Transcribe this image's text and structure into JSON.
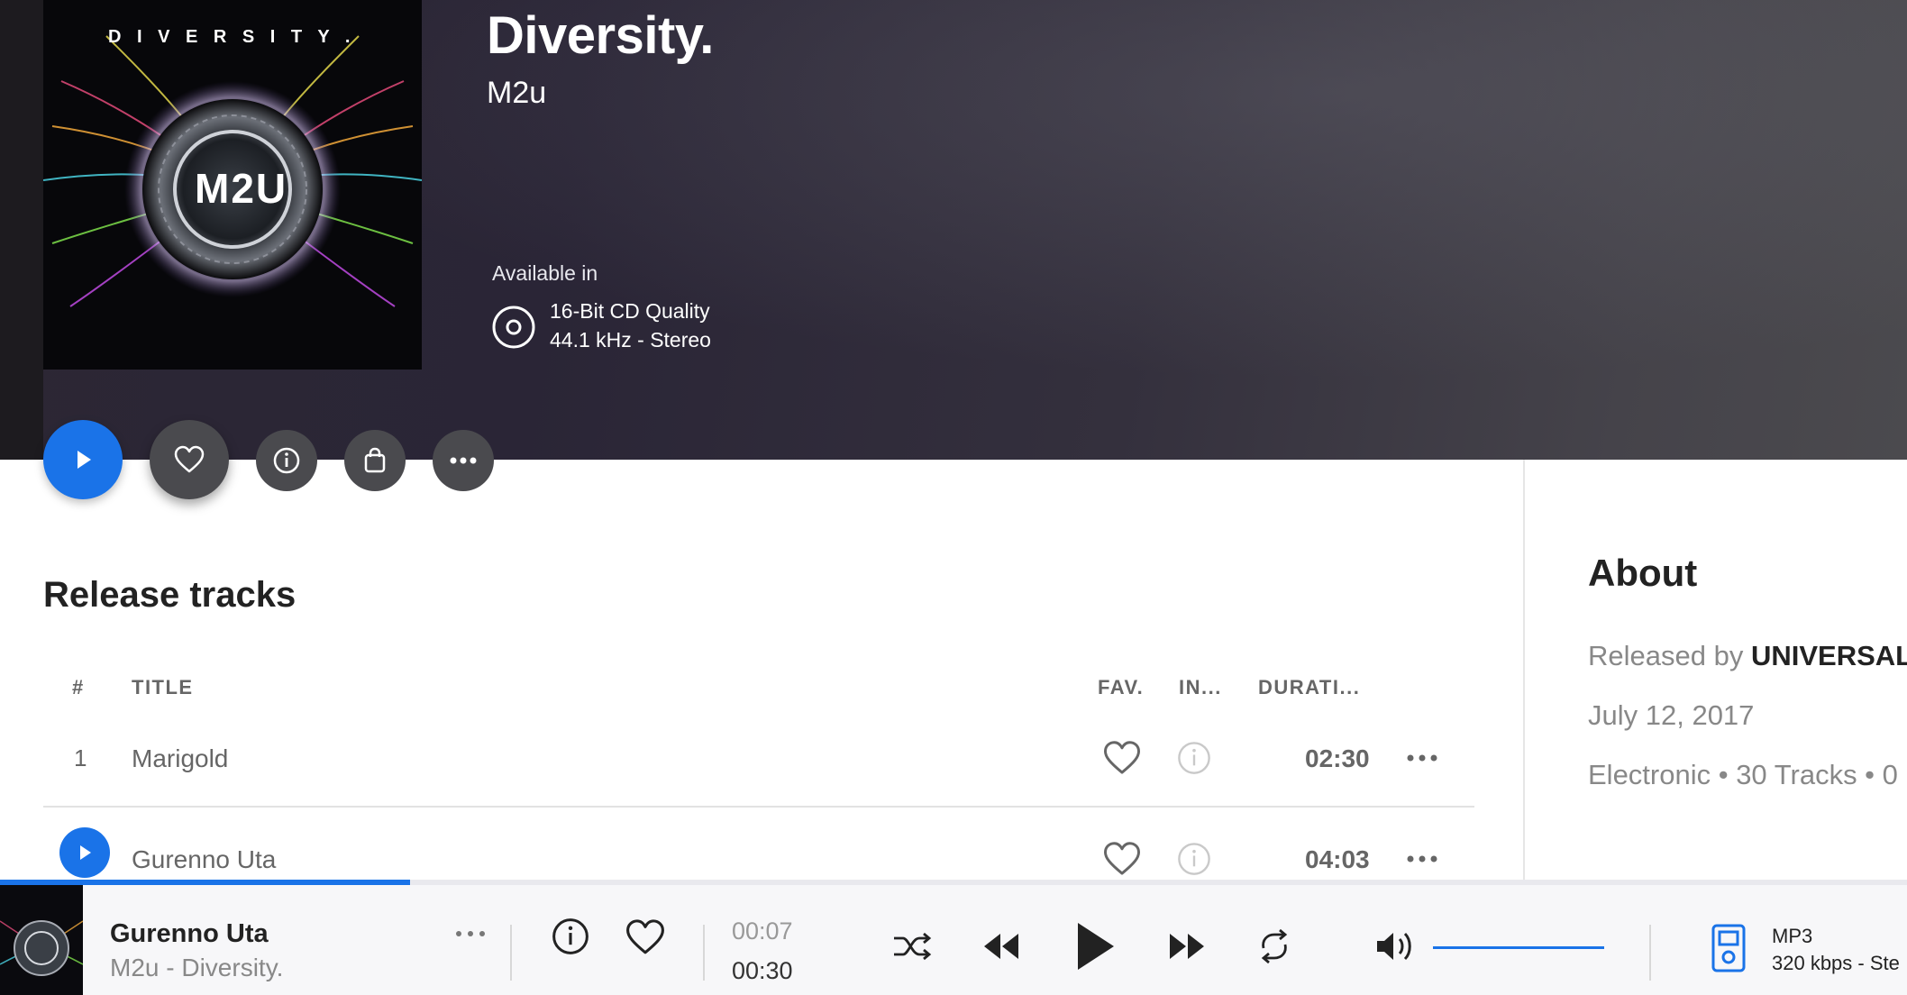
{
  "album": {
    "cover_text": "D I V E R S I T Y .",
    "cover_logo_text": "M2U",
    "title": "Diversity.",
    "artist": "M2u",
    "available_label": "Available in",
    "quality_line1": "16-Bit CD Quality",
    "quality_line2": "44.1 kHz - Stereo"
  },
  "actions": {
    "play_icon": "play-icon",
    "favorite_icon": "heart-icon",
    "info_icon": "info-icon",
    "buy_icon": "shopping-bag-icon",
    "more_icon": "more-icon"
  },
  "tracks": {
    "section_title": "Release tracks",
    "columns": {
      "number": "#",
      "title": "TITLE",
      "fav": "FAV.",
      "info": "IN...",
      "duration": "DURATI..."
    },
    "rows": [
      {
        "number": "1",
        "title": "Marigold",
        "duration": "02:30"
      },
      {
        "number": "",
        "title": "Gurenno Uta",
        "duration": "04:03"
      }
    ]
  },
  "about": {
    "title": "About",
    "released_by_prefix": "Released by",
    "label": "UNIVERSAL",
    "date": "July 12, 2017",
    "genre_line": "Electronic • 30 Tracks • 0"
  },
  "player": {
    "now_playing_title": "Gurenno Uta",
    "now_playing_sub": "M2u - Diversity.",
    "elapsed": "00:07",
    "total": "00:30",
    "progress_fraction": 0.215,
    "format": "MP3",
    "format_detail": "320 kbps - Ste",
    "volume_fraction": 1.0
  },
  "colors": {
    "accent": "#1a73e8",
    "hero_bg": "#2c2734",
    "button_dark": "#4a4a4e"
  }
}
